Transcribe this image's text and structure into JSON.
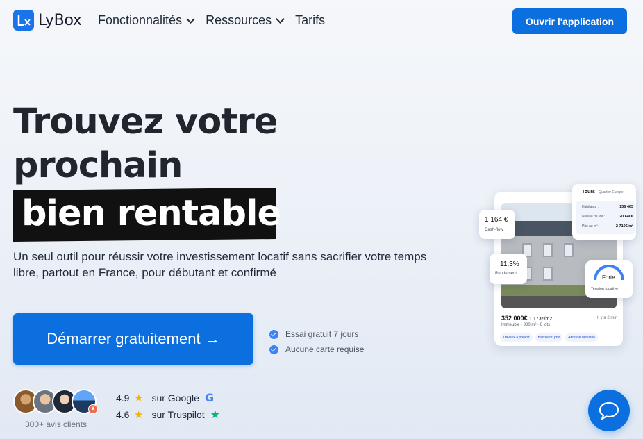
{
  "nav": {
    "logo_text": "LyBox",
    "menu": [
      {
        "label": "Fonctionnalités",
        "has_dropdown": true
      },
      {
        "label": "Ressources",
        "has_dropdown": true
      },
      {
        "label": "Tarifs",
        "has_dropdown": false
      }
    ],
    "cta_label": "Ouvrir l'application"
  },
  "hero": {
    "title_line1": "Trouvez votre",
    "title_line2": "prochain",
    "title_highlight": "bien rentable",
    "subtitle": "Un seul outil pour réussir votre investissement locatif sans sacrifier votre temps libre, partout en France, pour débutant et confirmé",
    "cta_label": "Démarrer gratuitement →",
    "checks": [
      "Essai gratuit 7 jours",
      "Aucune carte requise"
    ]
  },
  "reviews": {
    "clients_label": "300+ avis clients",
    "ratings": [
      {
        "score": "4.9",
        "source": "sur Google",
        "icon": "google-icon"
      },
      {
        "score": "4.6",
        "source": "sur Truspilot",
        "icon": "trustpilot-icon"
      }
    ]
  },
  "mock": {
    "cashflow_value": "1 164 €",
    "cashflow_label": "Cash-flow",
    "rendement_value": "11,3%",
    "rendement_label": "Rendement",
    "city": "Tours",
    "district": "· Quartier Europe",
    "stats": [
      {
        "label": "Habitants :",
        "value": "136 463"
      },
      {
        "label": "Niveau de vie :",
        "value": "20 640€"
      },
      {
        "label": "Prix au m² :",
        "value": "2 710€/m²"
      }
    ],
    "tension_value": "Forte",
    "tension_label": "Tension locative",
    "price": "352 000€",
    "price_m2": "1 173€/m2",
    "property_desc": "Immeuble · 300 m² · 6 lots",
    "time_ago": "Il y a 2 min",
    "chips": [
      "Travaux à prévoir",
      "Baisse du prix",
      "Adresse détectée"
    ]
  },
  "colors": {
    "accent": "#0b6fe0",
    "star": "#f5b301"
  }
}
